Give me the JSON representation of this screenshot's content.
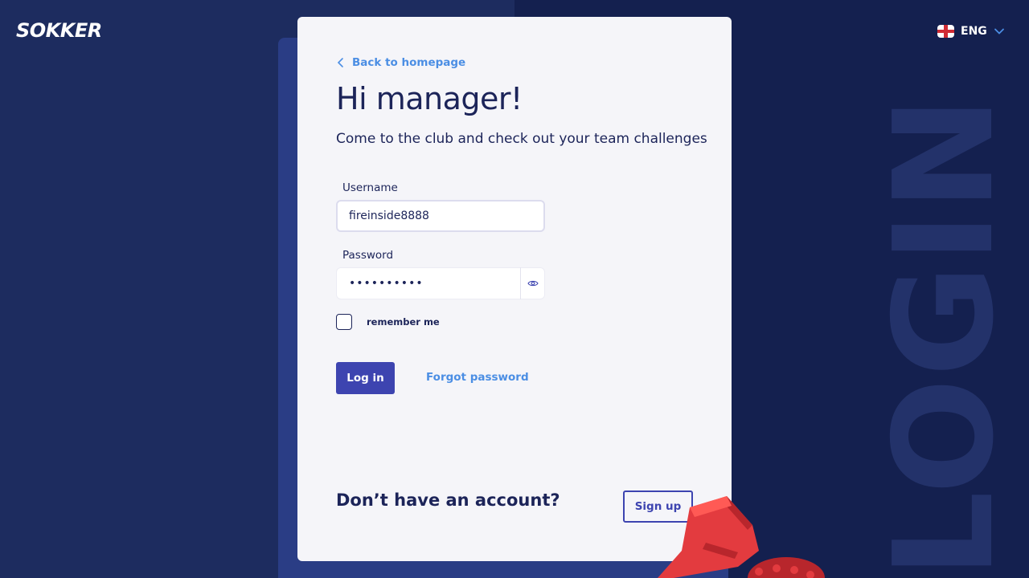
{
  "brand": {
    "logo": "SOKKER"
  },
  "language": {
    "code": "ENG",
    "flag_icon": "england-flag-icon"
  },
  "watermark": "LOGIN",
  "login": {
    "back_link": "Back to homepage",
    "title": "Hi manager!",
    "subtitle": "Come to the club and check out your team challenges",
    "username_label": "Username",
    "username_value": "fireinside8888",
    "password_label": "Password",
    "password_value": "••••••••••",
    "remember_label": "remember me",
    "remember_checked": false,
    "login_button": "Log in",
    "forgot_link": "Forgot password"
  },
  "signup": {
    "prompt": "Don’t have an account?",
    "button": "Sign up"
  },
  "colors": {
    "background": "#14204f",
    "card": "#f5f5f9",
    "primary": "#3d44b0",
    "link": "#4b8ee4",
    "text": "#1c2459",
    "accent_red": "#e33b3f"
  }
}
